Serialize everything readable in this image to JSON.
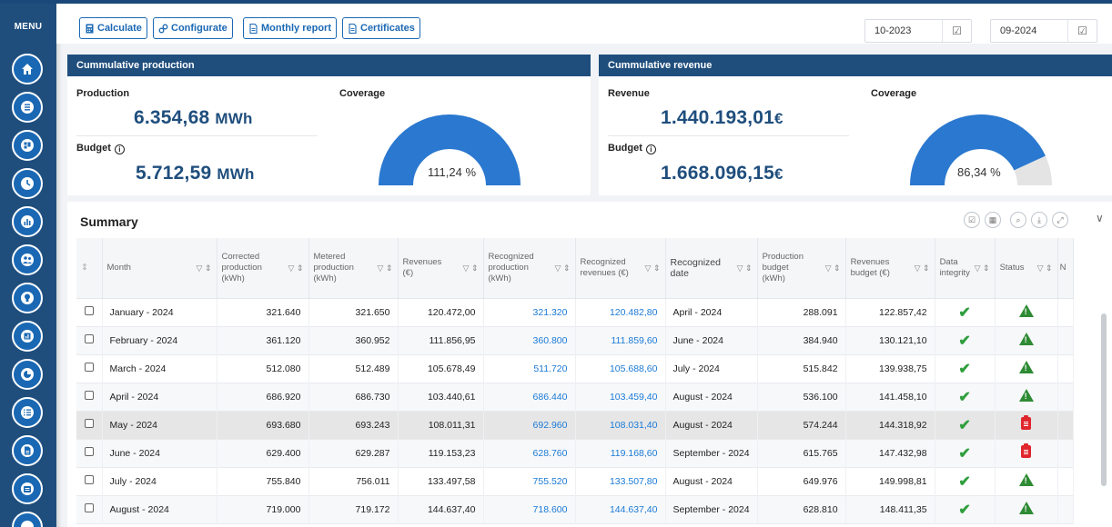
{
  "sidebar": {
    "menu_label": "MENU",
    "icons": [
      "home-icon",
      "list-icon",
      "dashboard-icon",
      "clock-icon",
      "bar-chart-icon",
      "users-icon",
      "lightbulb-icon",
      "analytics-icon",
      "pie-chart-icon",
      "checklist-icon",
      "document-icon",
      "archive-icon"
    ]
  },
  "toolbar": {
    "calculate": "Calculate",
    "configurate": "Configurate",
    "monthly_report": "Monthly report",
    "certificates": "Certificates",
    "date_from": "10-2023",
    "date_to": "09-2024"
  },
  "production": {
    "header": "Cummulative production",
    "production_label": "Production",
    "production_value": "6.354,68",
    "production_unit": "MWh",
    "budget_label": "Budget",
    "budget_value": "5.712,59",
    "budget_unit": "MWh",
    "coverage_label": "Coverage",
    "coverage_text": "111,24 %",
    "coverage_pct": 111.24
  },
  "revenue": {
    "header": "Cummulative revenue",
    "revenue_label": "Revenue",
    "revenue_value": "1.440.193,01",
    "revenue_unit": "€",
    "budget_label": "Budget",
    "budget_value": "1.668.096,15",
    "budget_unit": "€",
    "coverage_label": "Coverage",
    "coverage_text": "86,34 %",
    "coverage_pct": 86.34
  },
  "summary": {
    "title": "Summary",
    "columns": [
      "Month",
      "Corrected production (kWh)",
      "Metered production (kWh)",
      "Revenues (€)",
      "Recognized production (kWh)",
      "Recognized revenues (€)",
      "Recognized date",
      "Production budget (kWh)",
      "Revenues budget (€)",
      "Data integrity",
      "Status",
      "N"
    ],
    "rows": [
      {
        "month": "January - 2024",
        "corrected": "321.640",
        "metered": "321.650",
        "revenues": "120.472,00",
        "rec_prod": "321.320",
        "rec_rev": "120.482,80",
        "rec_date": "April - 2024",
        "prod_budget": "288.091",
        "rev_budget": "122.857,42",
        "integrity": "ok",
        "status": "warning"
      },
      {
        "month": "February - 2024",
        "corrected": "361.120",
        "metered": "360.952",
        "revenues": "111.856,95",
        "rec_prod": "360.800",
        "rec_rev": "111.859,60",
        "rec_date": "June - 2024",
        "prod_budget": "384.940",
        "rev_budget": "130.121,10",
        "integrity": "ok",
        "status": "warning"
      },
      {
        "month": "March - 2024",
        "corrected": "512.080",
        "metered": "512.489",
        "revenues": "105.678,49",
        "rec_prod": "511.720",
        "rec_rev": "105.688,60",
        "rec_date": "July - 2024",
        "prod_budget": "515.842",
        "rev_budget": "139.938,75",
        "integrity": "ok",
        "status": "warning"
      },
      {
        "month": "April - 2024",
        "corrected": "686.920",
        "metered": "686.730",
        "revenues": "103.440,61",
        "rec_prod": "686.440",
        "rec_rev": "103.459,40",
        "rec_date": "August - 2024",
        "prod_budget": "536.100",
        "rev_budget": "141.458,10",
        "integrity": "ok",
        "status": "warning"
      },
      {
        "month": "May - 2024",
        "corrected": "693.680",
        "metered": "693.243",
        "revenues": "108.011,31",
        "rec_prod": "692.960",
        "rec_rev": "108.031,40",
        "rec_date": "August - 2024",
        "prod_budget": "574.244",
        "rev_budget": "144.318,92",
        "integrity": "ok",
        "status": "report"
      },
      {
        "month": "June - 2024",
        "corrected": "629.400",
        "metered": "629.287",
        "revenues": "119.153,23",
        "rec_prod": "628.760",
        "rec_rev": "119.168,60",
        "rec_date": "September - 2024",
        "prod_budget": "615.765",
        "rev_budget": "147.432,98",
        "integrity": "ok",
        "status": "report"
      },
      {
        "month": "July - 2024",
        "corrected": "755.840",
        "metered": "756.011",
        "revenues": "133.497,58",
        "rec_prod": "755.520",
        "rec_rev": "133.507,80",
        "rec_date": "August - 2024",
        "prod_budget": "649.976",
        "rev_budget": "149.998,81",
        "integrity": "ok",
        "status": "warning"
      },
      {
        "month": "August - 2024",
        "corrected": "719.000",
        "metered": "719.172",
        "revenues": "144.637,40",
        "rec_prod": "718.600",
        "rec_rev": "144.637,40",
        "rec_date": "September - 2024",
        "prod_budget": "628.810",
        "rev_budget": "148.411,35",
        "integrity": "ok",
        "status": "warning"
      }
    ]
  },
  "colors": {
    "primary": "#1f4e7d",
    "accent": "#1a7ad6",
    "gauge_fill": "#2a78d0",
    "gauge_track": "#e4e4e4",
    "ok": "#2e9e3c",
    "status_warning": "#2e8b34",
    "status_report": "#e0262d"
  }
}
